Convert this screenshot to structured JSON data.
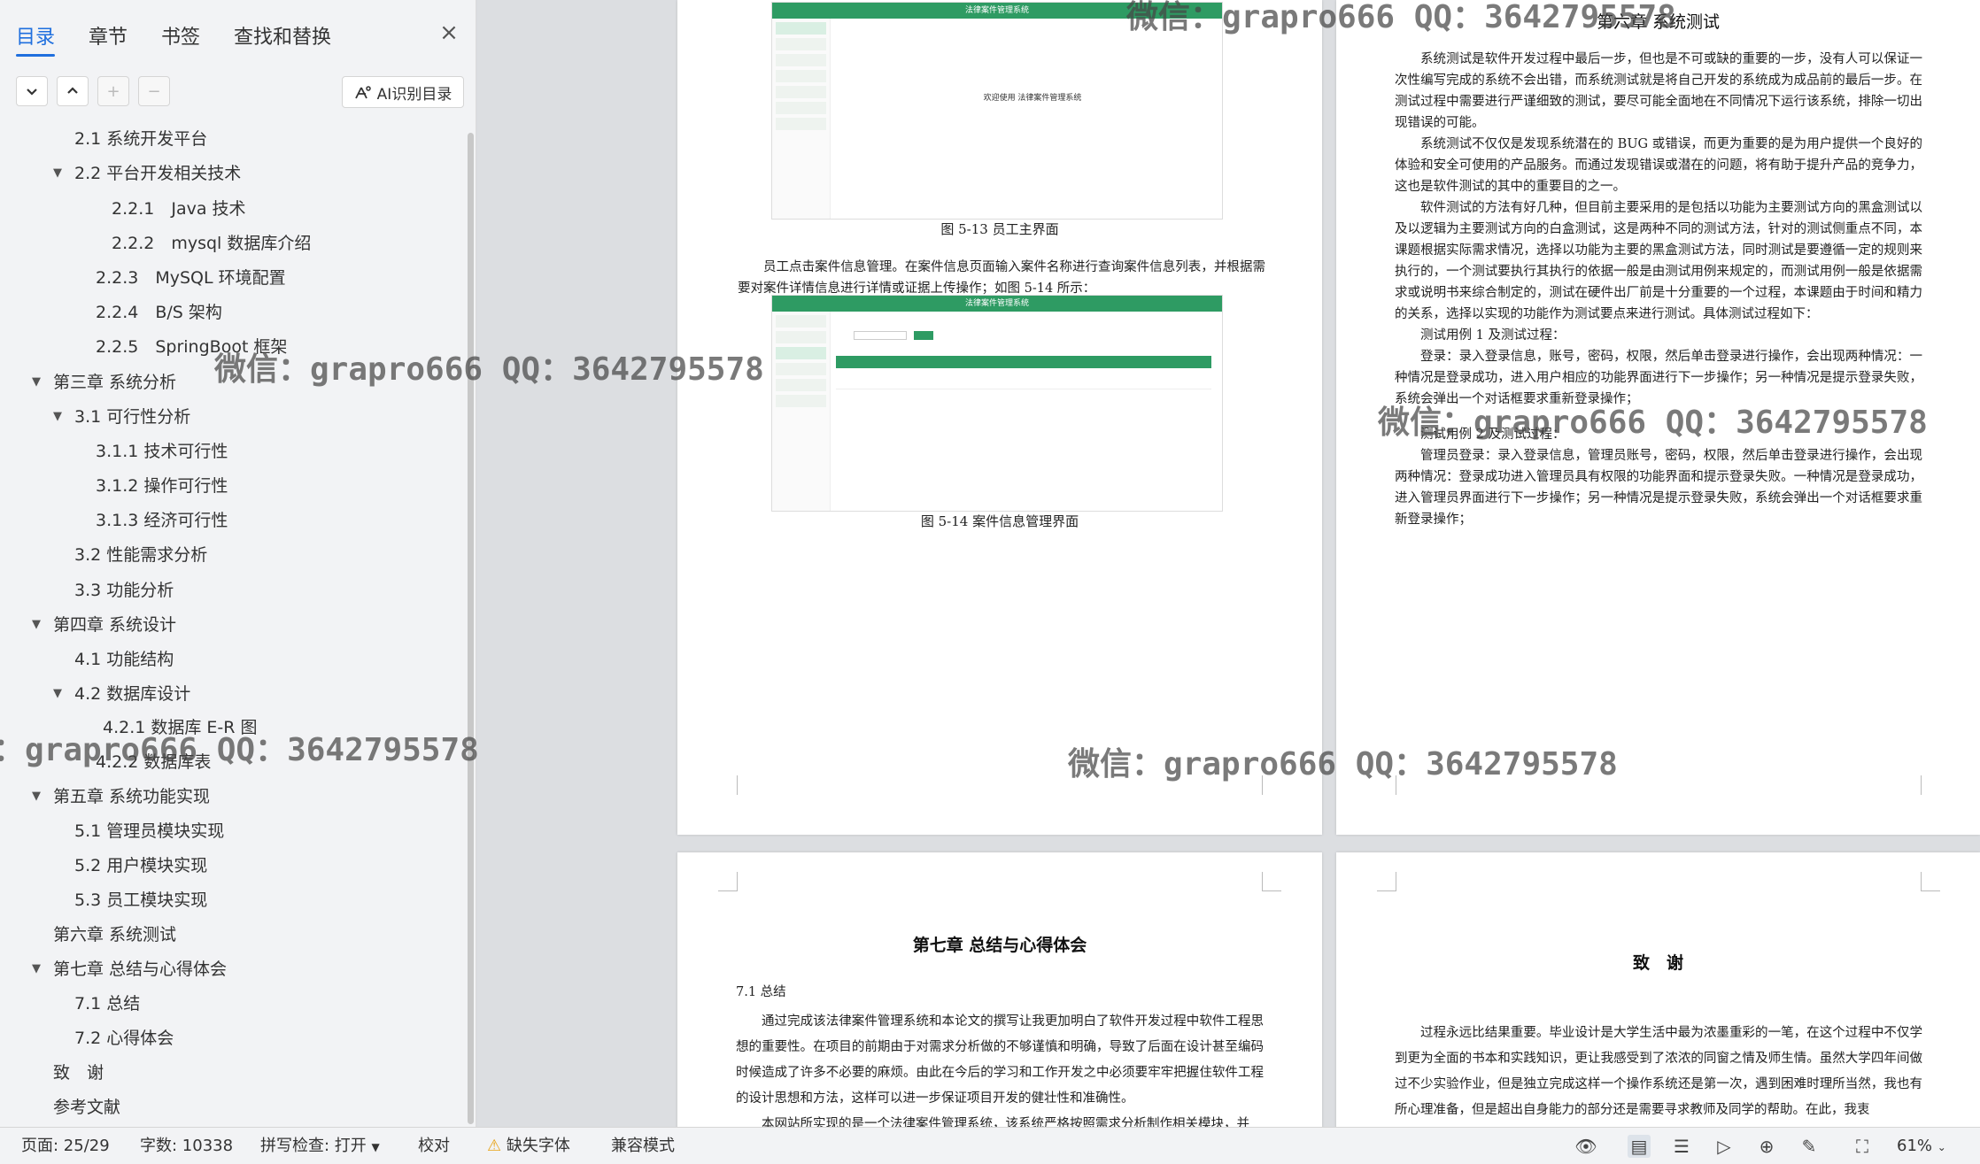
{
  "sidebar": {
    "tabs": [
      "目录",
      "章节",
      "书签",
      "查找和替换"
    ],
    "close_icon": "×",
    "toolbar": {
      "expand": "⌄",
      "collapse": "⌃",
      "add": "+",
      "remove": "−"
    },
    "ai_button": "AI识别目录",
    "toc": [
      "2.1 系统开发平台",
      "2.2 平台开发相关技术",
      "2.2.1　Java 技术",
      "2.2.2　mysql 数据库介绍",
      "2.2.3　MySQL 环境配置",
      "2.2.4　B/S 架构",
      "2.2.5　SpringBoot 框架",
      "第三章 系统分析",
      "3.1 可行性分析",
      "3.1.1 技术可行性",
      "3.1.2 操作可行性",
      "3.1.3 经济可行性",
      "3.2 性能需求分析",
      "3.3 功能分析",
      "第四章 系统设计",
      "4.1 功能结构",
      "4.2 数据库设计",
      "4.2.1 数据库 E-R 图",
      "4.2.2 数据库表",
      "第五章 系统功能实现",
      "5.1 管理员模块实现",
      "5.2 用户模块实现",
      "5.3 员工模块实现",
      "第六章 系统测试",
      "第七章 总结与心得体会",
      "7.1 总结",
      "7.2 心得体会",
      "致　谢",
      "参考文献"
    ]
  },
  "doc": {
    "fig513_caption": "图 5-13 员工主界面",
    "fig514_caption": "图 5-14 案件信息管理界面",
    "app_title": "法律案件管理系统",
    "welcome_text": "欢迎使用 法律案件管理系统",
    "para_case": "员工点击案件信息管理。在案件信息页面输入案件名称进行查询案件信息列表，并根据需要对案件详情信息进行详情或证据上传操作；如图 5-14 所示：",
    "ch6_title": "第六章 系统测试",
    "ch6_p1": "系统测试是软件开发过程中最后一步，但也是不可或缺的重要的一步，没有人可以保证一次性编写完成的系统不会出错，而系统测试就是将自己开发的系统成为成品前的最后一步。在测试过程中需要进行严谨细致的测试，要尽可能全面地在不同情况下运行该系统，排除一切出现错误的可能。",
    "ch6_p2": "系统测试不仅仅是发现系统潜在的 BUG 或错误，而更为重要的是为用户提供一个良好的体验和安全可使用的产品服务。而通过发现错误或潜在的问题，将有助于提升产品的竞争力，这也是软件测试的其中的重要目的之一。",
    "ch6_p3": "软件测试的方法有好几种，但目前主要采用的是包括以功能为主要测试方向的黑盒测试以及以逻辑为主要测试方向的白盒测试，这是两种不同的测试方法，针对的测试侧重点不同，本课题根据实际需求情况，选择以功能为主要的黑盒测试方法，同时测试是要遵循一定的规则来执行的，一个测试要执行其执行的依据一般是由测试用例来规定的，而测试用例一般是依据需求或说明书来综合制定的，测试在硬件出厂前是十分重要的一个过程，本课题由于时间和精力的关系，选择以实现的功能作为测试要点来进行测试。具体测试过程如下：",
    "ch6_p4": "测试用例 1 及测试过程：",
    "ch6_p5": "登录：录入登录信息，账号，密码，权限，然后单击登录进行操作，会出现两种情况：一种情况是登录成功，进入用户相应的功能界面进行下一步操作；另一种情况是提示登录失败，系统会弹出一个对话框要求重新登录操作；",
    "ch6_p6": "测试用例 2 及测试过程：",
    "ch6_p7": "管理员登录：录入登录信息，管理员账号，密码，权限，然后单击登录进行操作，会出现两种情况：登录成功进入管理员具有权限的功能界面和提示登录失败。一种情况是登录成功，进入管理员界面进行下一步操作；另一种情况是提示登录失败，系统会弹出一个对话框要求重新登录操作；",
    "ch7_title": "第七章 总结与心得体会",
    "ch7_s1": "7.1 总结",
    "ch7_p1": "通过完成该法律案件管理系统和本论文的撰写让我更加明白了软件开发过程中软件工程思想的重要性。在项目的前期由于对需求分析做的不够谨慎和明确，导致了后面在设计甚至编码时候造成了许多不必要的麻烦。由此在今后的学习和工作开发之中必须要牢牢把握住软件工程的设计思想和方法，这样可以进一步保证项目开发的健壮性和准确性。",
    "ch7_p2": "本网站所实现的是一个法律案件管理系统，该系统严格按照需求分析制作相关模块，并",
    "thanks_title": "致　谢",
    "thanks_p1": "过程永远比结果重要。毕业设计是大学生活中最为浓墨重彩的一笔，在这个过程中不仅学到更为全面的书本和实践知识，更让我感受到了浓浓的同窗之情及师生情。虽然大学四年间做过不少实验作业，但是独立完成这样一个操作系统还是第一次，遇到困难时理所当然，我也有所心理准备，但是超出自身能力的部分还是需要寻求教师及同学的帮助。在此，我衷"
  },
  "watermark": "微信：grapro666 QQ：3642795578",
  "statusbar": {
    "page": "页面: 25/29",
    "words": "字数: 10338",
    "spell": "拼写检查: 打开",
    "proof": "校对",
    "missing_font": "缺失字体",
    "compat": "兼容模式",
    "zoom": "61%"
  },
  "colors": {
    "accent": "#1f6fde",
    "app_green": "#2e9b63",
    "warning": "#e8a317"
  }
}
